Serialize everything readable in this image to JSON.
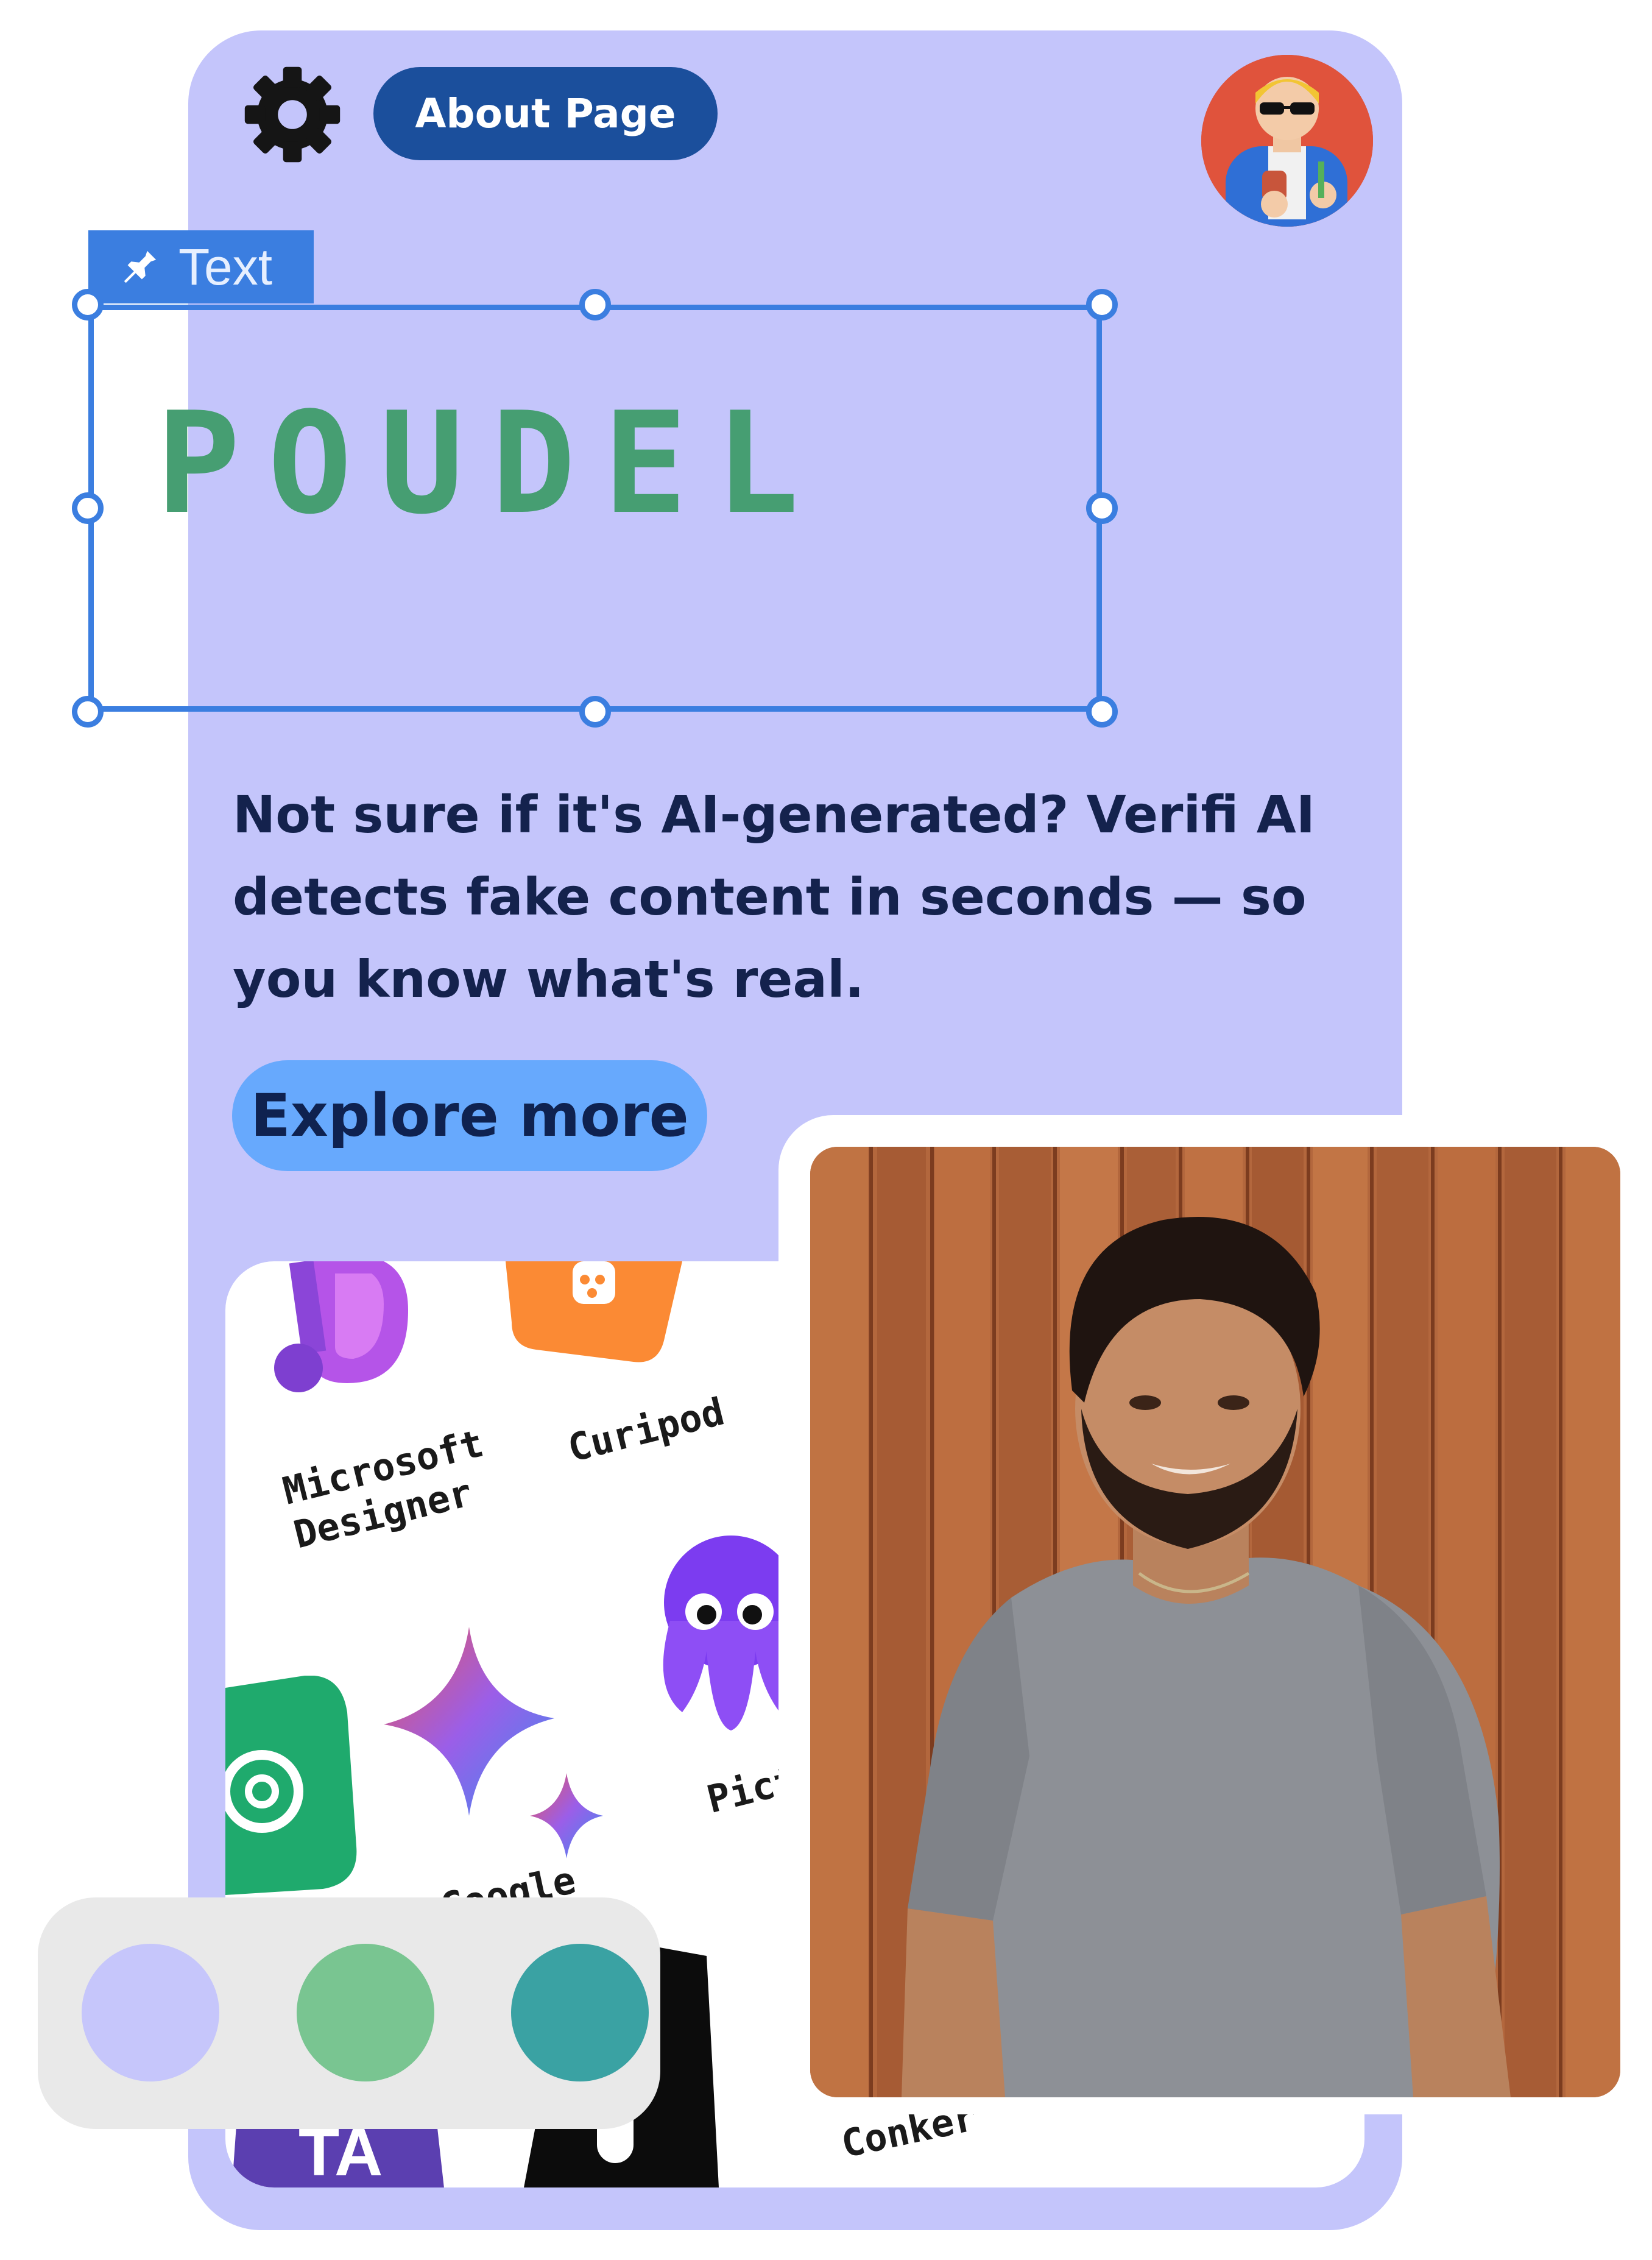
{
  "header": {
    "about_label": "About Page"
  },
  "selection": {
    "tag_label": "Text"
  },
  "hero": {
    "title": "POUDEL",
    "description": "Not sure if it's AI-generated? Verifi AI detects fake content in seconds — so you know what's real.",
    "explore_label": "Explore more"
  },
  "apps": [
    {
      "label": "Microsoft\nDesigner",
      "icon": "microsoft-designer-icon"
    },
    {
      "label": "Curipod",
      "icon": "curipod-icon"
    },
    {
      "label": "Pict",
      "icon": "octopus-icon"
    },
    {
      "label": "Google\nmini",
      "icon": "gemini-sparkle-icon"
    },
    {
      "label": "Conker",
      "icon": ""
    }
  ],
  "palette": {
    "colors": [
      "#c6c6fb",
      "#79c591",
      "#3aa2a3"
    ]
  },
  "colors": {
    "card_bg": "#c4c5fb",
    "accent": "#1b4f9c",
    "selection": "#3b7ee0",
    "title_green": "#469e72",
    "button": "#67a9fd"
  }
}
